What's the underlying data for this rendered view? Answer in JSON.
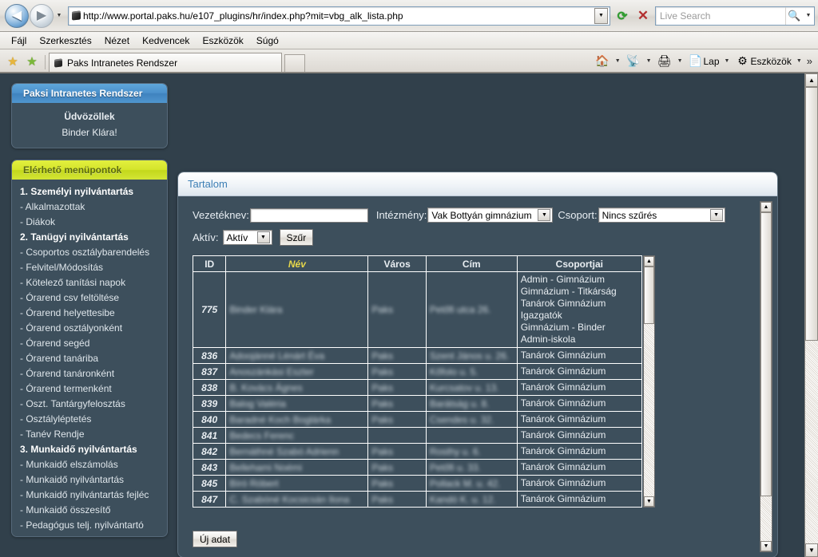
{
  "browser": {
    "url": "http://www.portal.paks.hu/e107_plugins/hr/index.php?mit=vbg_alk_lista.php",
    "search_placeholder": "Live Search",
    "back_label": "Back",
    "forward_label": "Forward",
    "refresh_label": "Refresh",
    "stop_label": "Stop",
    "menu": [
      "Fájl",
      "Szerkesztés",
      "Nézet",
      "Kedvencek",
      "Eszközök",
      "Súgó"
    ],
    "tab_title": "Paks Intranetes Rendszer",
    "command_bar": [
      {
        "icon": "home-icon",
        "label": ""
      },
      {
        "icon": "feeds-icon",
        "label": ""
      },
      {
        "icon": "printer-icon",
        "label": ""
      },
      {
        "icon": "page-icon",
        "label": "Lap"
      },
      {
        "icon": "tools-icon",
        "label": "Eszközök"
      }
    ],
    "overflow_label": "»"
  },
  "sidebar": {
    "header": "Paksi Intranetes Rendszer",
    "welcome_title": "Üdvözöllek",
    "welcome_user": "Binder Klára!",
    "menu_header": "Elérhető menüpontok",
    "menu_items": [
      {
        "label": "1. Személyi nyilvántartás",
        "bold": true
      },
      {
        "label": "- Alkalmazottak",
        "bold": false
      },
      {
        "label": "- Diákok",
        "bold": false
      },
      {
        "label": "2. Tanügyi nyilvántartás",
        "bold": true
      },
      {
        "label": "- Csoportos osztálybarendelés",
        "bold": false
      },
      {
        "label": "- Felvitel/Módosítás",
        "bold": false
      },
      {
        "label": "- Kötelező tanítási napok",
        "bold": false
      },
      {
        "label": "- Órarend csv feltöltése",
        "bold": false
      },
      {
        "label": "- Órarend helyettesibe",
        "bold": false
      },
      {
        "label": "- Órarend osztályonként",
        "bold": false
      },
      {
        "label": "- Órarend segéd",
        "bold": false
      },
      {
        "label": "- Órarend tanáriba",
        "bold": false
      },
      {
        "label": "- Órarend tanáronként",
        "bold": false
      },
      {
        "label": "- Órarend termenként",
        "bold": false
      },
      {
        "label": "- Oszt. Tantárgyfelosztás",
        "bold": false
      },
      {
        "label": "- Osztályléptetés",
        "bold": false
      },
      {
        "label": "- Tanév Rendje",
        "bold": false
      },
      {
        "label": "3. Munkaidő nyilvántartás",
        "bold": true
      },
      {
        "label": "- Munkaidő elszámolás",
        "bold": false
      },
      {
        "label": "- Munkaidő nyilvántartás",
        "bold": false
      },
      {
        "label": "- Munkaidő nyilvántartás fejléc",
        "bold": false
      },
      {
        "label": "- Munkaidő összesítő",
        "bold": false
      },
      {
        "label": "- Pedagógus telj. nyilvántartó",
        "bold": false
      }
    ]
  },
  "content": {
    "header": "Tartalom",
    "filter": {
      "vezeteknev_label": "Vezetéknev:",
      "vezeteknev_value": "",
      "intezmeny_label": "Intézmény:",
      "intezmeny_value": "Vak Bottyán gimnázium",
      "csoport_label": "Csoport:",
      "csoport_value": "Nincs szűrés",
      "aktiv_label": "Aktív:",
      "aktiv_value": "Aktív",
      "filter_button": "Szűr"
    },
    "table": {
      "columns": [
        "ID",
        "Név",
        "Város",
        "Cím",
        "Csoportjai"
      ],
      "rows": [
        {
          "id": "775",
          "nev": "Binder Klára",
          "varos": "Paks",
          "cim": "Petőfi utca 26.",
          "csoportjai": "Admin - Gimnázium\nGimnázium - Titkárság\nTanárok Gimnázium\nIgazgatók\nGimnázium - Binder\nAdmin-iskola"
        },
        {
          "id": "836",
          "nev": "Adoojánné Lénárt Éva",
          "varos": "Paks",
          "cim": "Szent János u. 26.",
          "csoportjai": "Tanárok Gimnázium"
        },
        {
          "id": "837",
          "nev": "Anoszánkási Eszter",
          "varos": "Paks",
          "cim": "Kőfolo u. 5.",
          "csoportjai": "Tanárok Gimnázium"
        },
        {
          "id": "838",
          "nev": "B. Kovács Ágnes",
          "varos": "Paks",
          "cim": "Kurcsatov u. 13.",
          "csoportjai": "Tanárok Gimnázium"
        },
        {
          "id": "839",
          "nev": "Balog Valéria",
          "varos": "Paks",
          "cim": "Barátság u. 8.",
          "csoportjai": "Tanárok Gimnázium"
        },
        {
          "id": "840",
          "nev": "Baradné Koch Boglárka",
          "varos": "Paks",
          "cim": "Csendes u. 32.",
          "csoportjai": "Tanárok Gimnázium"
        },
        {
          "id": "841",
          "nev": "Bedecs Ferenc",
          "varos": "",
          "cim": "",
          "csoportjai": "Tanárok Gimnázium"
        },
        {
          "id": "842",
          "nev": "Bernáthné Szabó Adrienn",
          "varos": "Paks",
          "cim": "Rosthy u. 6.",
          "csoportjai": "Tanárok Gimnázium"
        },
        {
          "id": "843",
          "nev": "Bellehami Noémi",
          "varos": "Paks",
          "cim": "Petőfi u. 33.",
          "csoportjai": "Tanárok Gimnázium"
        },
        {
          "id": "845",
          "nev": "Bíró Róbert",
          "varos": "Paks",
          "cim": "Pollack M. u. 42.",
          "csoportjai": "Tanárok Gimnázium"
        },
        {
          "id": "847",
          "nev": "C. Szabóné Kocsicsán Ilona",
          "varos": "Paks",
          "cim": "Kandó K. u. 12.",
          "csoportjai": "Tanárok Gimnázium"
        }
      ]
    },
    "new_button": "Új adat"
  }
}
